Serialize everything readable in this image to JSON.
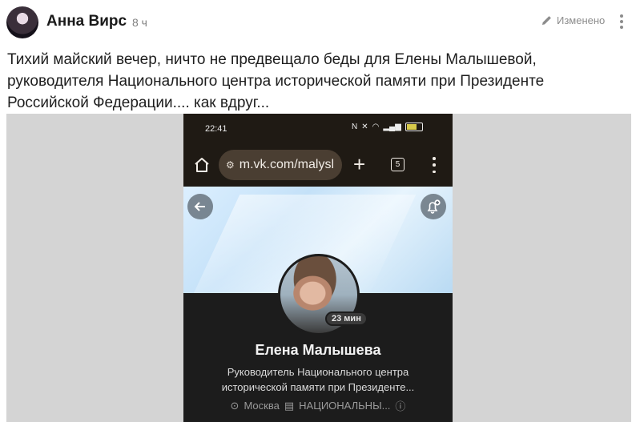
{
  "post": {
    "author": "Анна Вирс",
    "time": "8 ч",
    "edited_label": "Изменено",
    "text": "Тихий майский вечер, ничто не предвещало беды для Елены Малышевой, руководителя Национального центра исторической памяти при Президенте Российской Федерации.... как вдруг..."
  },
  "phone": {
    "status_time": "22:41",
    "url": "m.vk.com/malysl",
    "tab_count": "5",
    "online": "23 мин",
    "profile_name": "Елена Малышева",
    "profile_status": "Руководитель Национального центра исторической памяти при Президенте...",
    "city": "Москва",
    "workplace": "НАЦИОНАЛЬНЫ..."
  },
  "icons": {
    "edit": "pencil-icon",
    "more": "more-vertical-icon",
    "home": "home-icon",
    "site": "site-settings-icon",
    "plus": "plus-icon",
    "tabs": "tabs-icon",
    "menu": "menu-vertical-icon",
    "back": "back-arrow-icon",
    "bell": "bell-plus-icon",
    "location": "location-icon",
    "work": "briefcase-icon",
    "info": "info-icon"
  }
}
